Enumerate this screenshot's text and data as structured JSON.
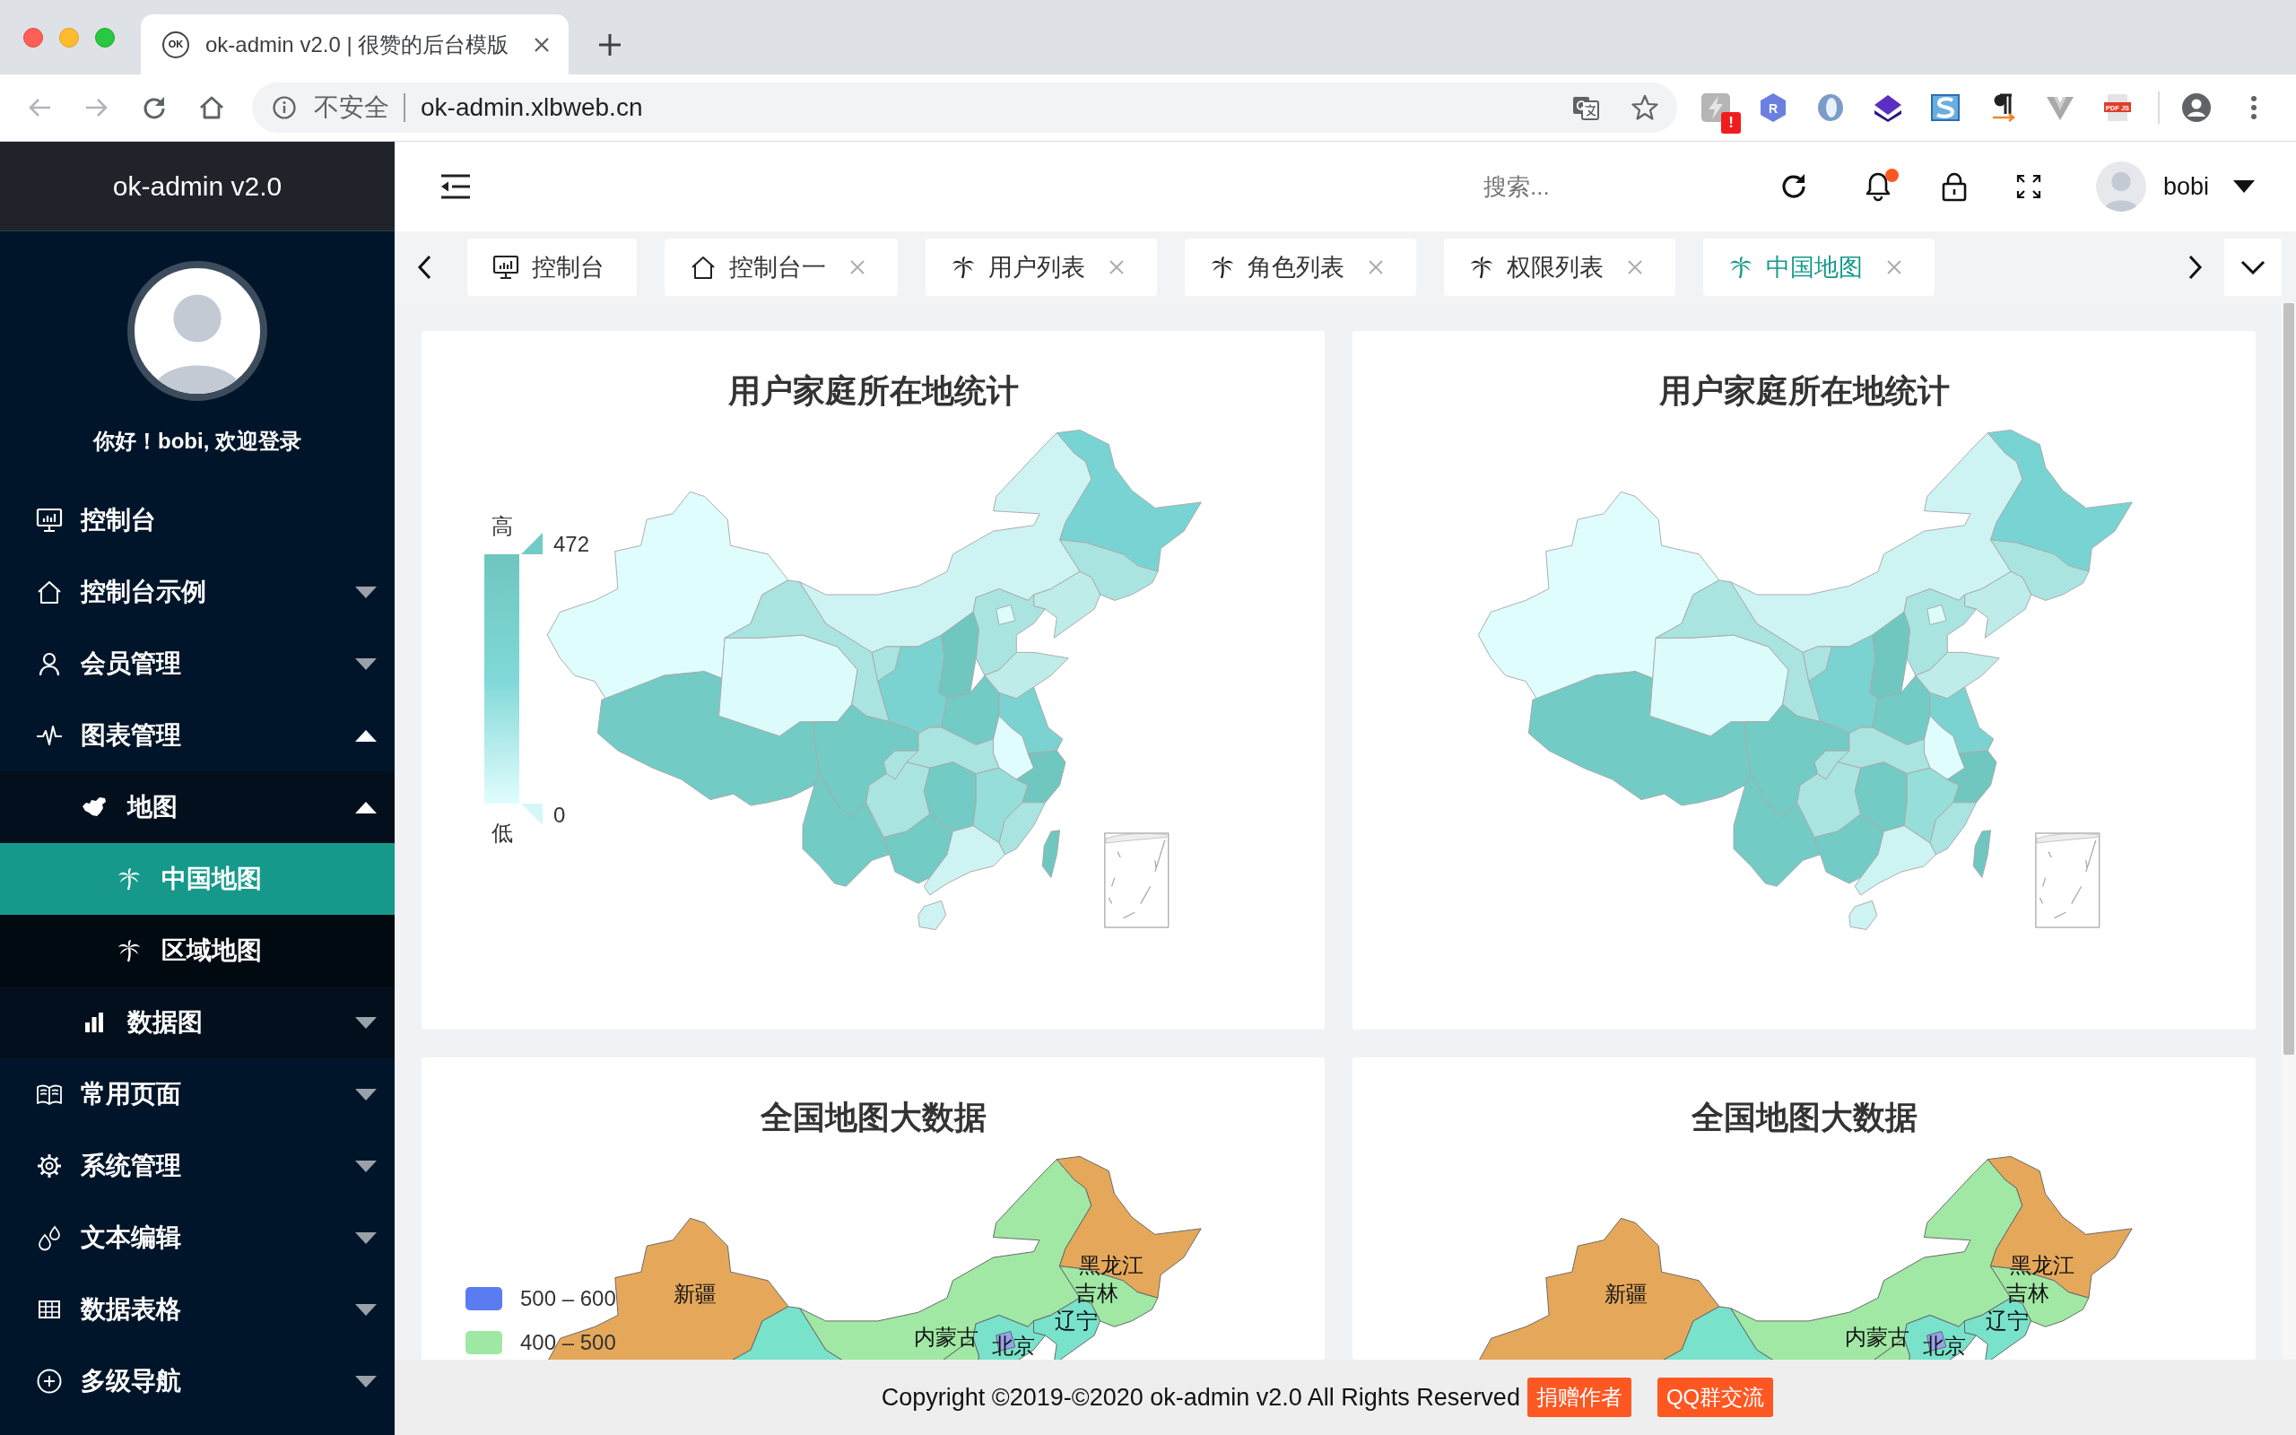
{
  "browser": {
    "favicon_text": "OK",
    "tab_title": "ok-admin v2.0 | 很赞的后台模版",
    "security_label": "不安全",
    "url": "ok-admin.xlbweb.cn",
    "extension_badge": "!",
    "extension_letter": "R",
    "extension_pdf_label": "PDF JS"
  },
  "sidebar": {
    "logo": "ok-admin v2.0",
    "greeting": "你好！bobi, 欢迎登录",
    "menu": [
      {
        "label": "控制台",
        "kind": "link",
        "selected": false
      },
      {
        "label": "控制台示例",
        "kind": "group",
        "selected": false,
        "expanded": false
      },
      {
        "label": "会员管理",
        "kind": "group",
        "selected": false,
        "expanded": false
      },
      {
        "label": "图表管理",
        "kind": "group",
        "selected": false,
        "expanded": true,
        "children": [
          {
            "label": "地图",
            "kind": "group",
            "selected": false,
            "expanded": true,
            "children": [
              {
                "label": "中国地图",
                "kind": "link",
                "selected": true
              },
              {
                "label": "区域地图",
                "kind": "link",
                "selected": false
              }
            ]
          },
          {
            "label": "数据图",
            "kind": "group",
            "selected": false,
            "expanded": false
          }
        ]
      },
      {
        "label": "常用页面",
        "kind": "group",
        "selected": false,
        "expanded": false
      },
      {
        "label": "系统管理",
        "kind": "group",
        "selected": false,
        "expanded": false
      },
      {
        "label": "文本编辑",
        "kind": "group",
        "selected": false,
        "expanded": false
      },
      {
        "label": "数据表格",
        "kind": "group",
        "selected": false,
        "expanded": false
      },
      {
        "label": "多级导航",
        "kind": "group",
        "selected": false,
        "expanded": false
      }
    ]
  },
  "header": {
    "search_placeholder": "搜索...",
    "unread_notifications": true,
    "username": "bobi"
  },
  "tabs": [
    {
      "label": "控制台",
      "closable": false,
      "selected": false
    },
    {
      "label": "控制台一",
      "closable": true,
      "selected": false
    },
    {
      "label": "用户列表",
      "closable": true,
      "selected": false
    },
    {
      "label": "角色列表",
      "closable": true,
      "selected": false
    },
    {
      "label": "权限列表",
      "closable": true,
      "selected": false
    },
    {
      "label": "中国地图",
      "closable": true,
      "selected": true
    }
  ],
  "cards": [
    {
      "title": "用户家庭所在地统计",
      "kind": "continuous",
      "legend": {
        "high_label": "高",
        "max": "472",
        "min": "0",
        "low_label": "低"
      }
    },
    {
      "title": "用户家庭所在地统计",
      "kind": "continuous"
    },
    {
      "title": "全国地图大数据",
      "kind": "pieces",
      "legend": [
        {
          "label": "500 – 600",
          "color": "#5b7cf0"
        },
        {
          "label": "400 – 500",
          "color": "#9fe8a3"
        }
      ],
      "regions": [
        "新疆",
        "黑龙江",
        "吉林",
        "辽宁",
        "内蒙古",
        "北京"
      ]
    },
    {
      "title": "全国地图大数据",
      "kind": "pieces",
      "regions": [
        "新疆",
        "黑龙江",
        "吉林",
        "辽宁",
        "内蒙古",
        "北京"
      ]
    }
  ],
  "footer": {
    "copyright": "Copyright ©2019-©2020 ok-admin v2.0 All Rights Reserved",
    "links": [
      "捐赠作者",
      "QQ群交流"
    ]
  }
}
